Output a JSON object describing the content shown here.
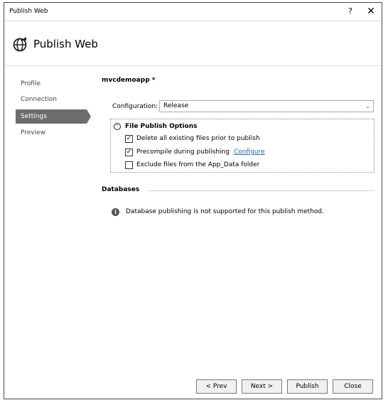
{
  "window": {
    "title": "Publish Web",
    "help_label": "?",
    "close_label": "✕"
  },
  "header": {
    "title": "Publish Web",
    "icon": "globe-publish-icon"
  },
  "nav": {
    "items": [
      {
        "label": "Profile"
      },
      {
        "label": "Connection"
      },
      {
        "label": "Settings"
      },
      {
        "label": "Preview"
      }
    ],
    "active": "Settings"
  },
  "settings": {
    "project_name": "mvcdemoapp *",
    "configuration_label": "Configuration:",
    "configuration_value": "Release",
    "file_publish_options": {
      "title": "File Publish Options",
      "delete_files": {
        "label": "Delete all existing files prior to publish",
        "checked": true
      },
      "precompile": {
        "label": "Precompile during publishing",
        "checked": true,
        "link": "Configure"
      },
      "exclude_app_data": {
        "label": "Exclude files from the App_Data folder",
        "checked": false
      }
    },
    "databases": {
      "title": "Databases",
      "message": "Database publishing is not supported for this publish method."
    }
  },
  "footer": {
    "prev_label": "< Prev",
    "next_label": "Next >",
    "publish_label": "Publish",
    "close_label": "Close"
  }
}
